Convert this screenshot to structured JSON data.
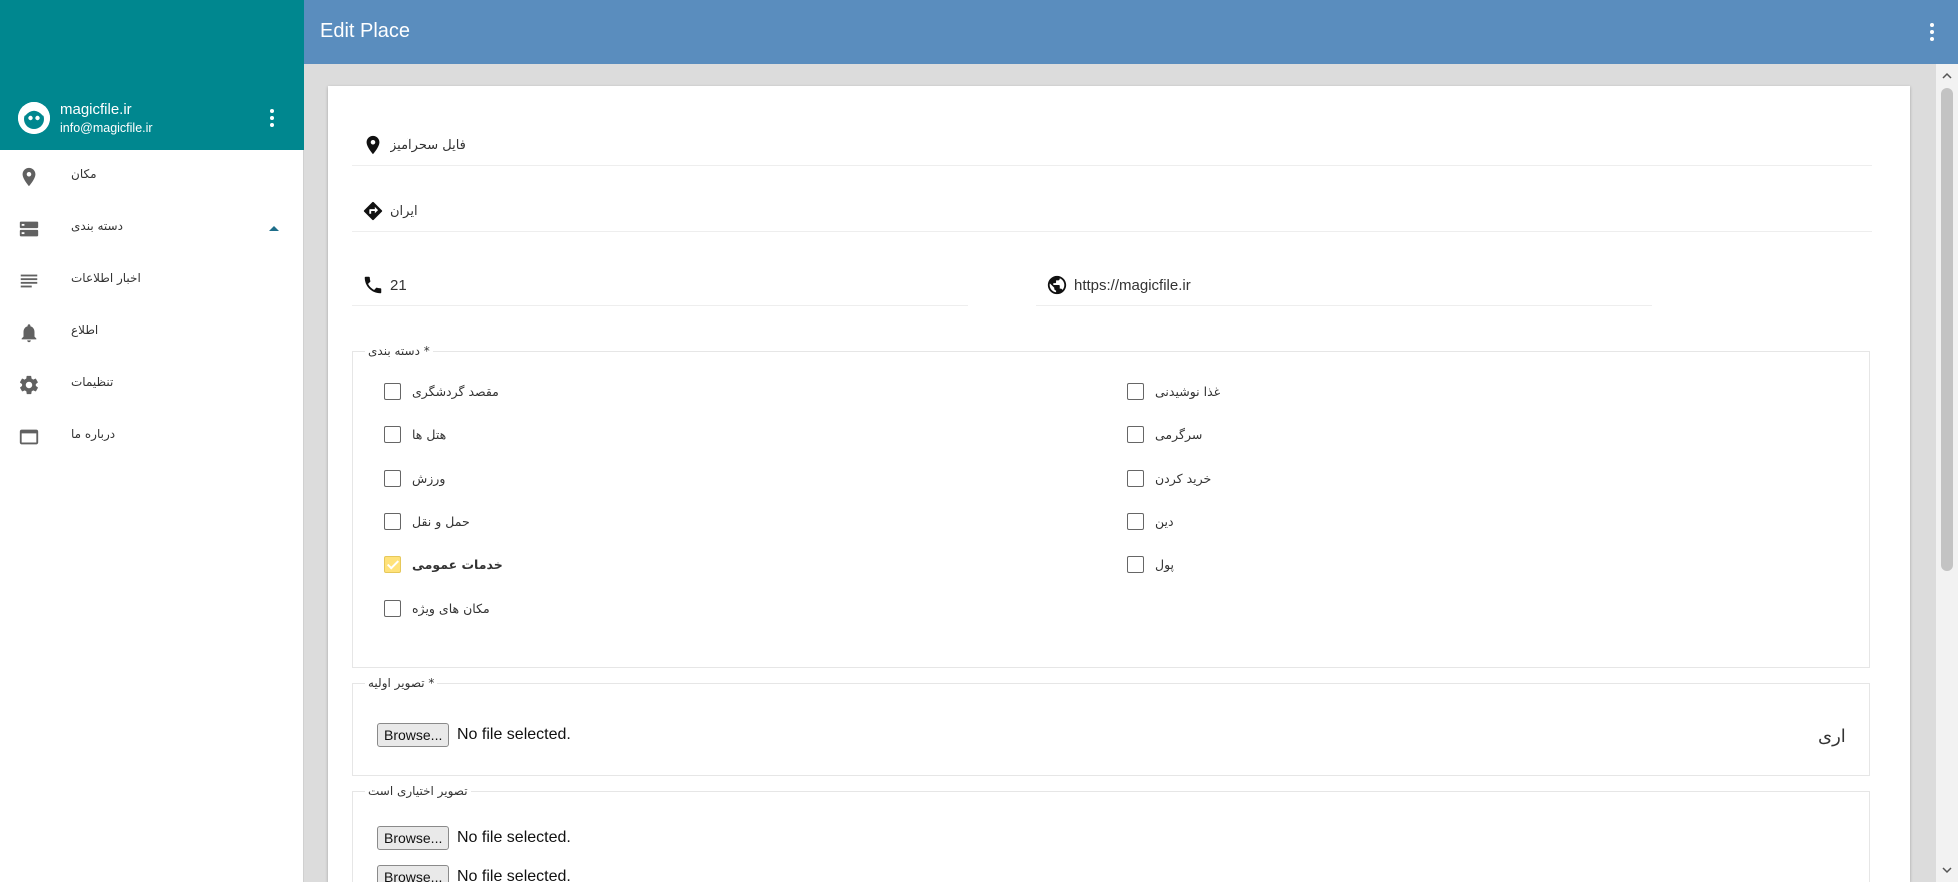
{
  "app": {
    "title": "Edit Place"
  },
  "sidebar": {
    "user": {
      "name": "magicfile.ir",
      "email": "info@magicfile.ir"
    },
    "items": [
      {
        "label": "مکان",
        "icon": "location-pin-icon"
      },
      {
        "label": "دسته بندی",
        "icon": "category-list-icon",
        "expanded": true
      },
      {
        "label": "اخبار اطلاعات",
        "icon": "news-lines-icon"
      },
      {
        "label": "اطلاع",
        "icon": "bell-icon"
      },
      {
        "label": "تنظیمات",
        "icon": "gear-icon"
      },
      {
        "label": "درباره ما",
        "icon": "window-icon"
      }
    ]
  },
  "form": {
    "name_value": "فایل سحرآمیز",
    "address_value": "ایران",
    "phone_value": "21",
    "website_value": "https://magicfile.ir",
    "category_legend": "دسته بندی *",
    "categories_right": [
      {
        "label": "مقصد گردشگری",
        "checked": false
      },
      {
        "label": "هتل ها",
        "checked": false
      },
      {
        "label": "ورزش",
        "checked": false
      },
      {
        "label": "حمل و نقل",
        "checked": false
      },
      {
        "label": "خدمات عمومی",
        "checked": true
      },
      {
        "label": "مکان های ویژه",
        "checked": false
      }
    ],
    "categories_left": [
      {
        "label": "غذا نوشیدنی",
        "checked": false
      },
      {
        "label": "سرگرمی",
        "checked": false
      },
      {
        "label": "خرید کردن",
        "checked": false
      },
      {
        "label": "دین",
        "checked": false
      },
      {
        "label": "پول",
        "checked": false
      }
    ],
    "primary_image_legend": "تصویر اولیه *",
    "primary_image_preview": "ارى",
    "optional_image_legend": "تصویر اختیاری است",
    "browse_label": "Browse...",
    "no_file_label": "No file selected."
  },
  "colors": {
    "sidebar_header": "#00878f",
    "topbar": "#5a8dbe",
    "content_bg": "#dcdcdc",
    "checked_box": "#ffe27a"
  }
}
